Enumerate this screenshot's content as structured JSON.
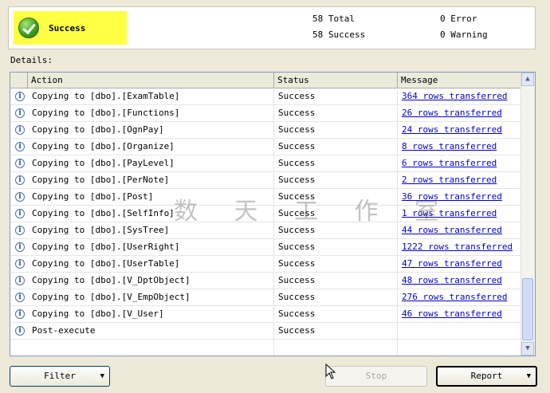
{
  "summary": {
    "status": "Success",
    "total": "58 Total",
    "success": "58 Success",
    "error": "0 Error",
    "warning": "0 Warning"
  },
  "details_label": "Details:",
  "columns": [
    "Action",
    "Status",
    "Message"
  ],
  "rows": [
    {
      "action": "Copying to [dbo].[ExamTable]",
      "status": "Success",
      "message": "364 rows transferred"
    },
    {
      "action": "Copying to [dbo].[Functions]",
      "status": "Success",
      "message": "26 rows transferred"
    },
    {
      "action": "Copying to [dbo].[OgnPay]",
      "status": "Success",
      "message": "24 rows transferred"
    },
    {
      "action": "Copying to [dbo].[Organize]",
      "status": "Success",
      "message": "8 rows transferred"
    },
    {
      "action": "Copying to [dbo].[PayLevel]",
      "status": "Success",
      "message": "6 rows transferred"
    },
    {
      "action": "Copying to [dbo].[PerNote]",
      "status": "Success",
      "message": "2 rows transferred"
    },
    {
      "action": "Copying to [dbo].[Post]",
      "status": "Success",
      "message": "36 rows transferred"
    },
    {
      "action": "Copying to [dbo].[SelfInfo]",
      "status": "Success",
      "message": "1 rows transferred"
    },
    {
      "action": "Copying to [dbo].[SysTree]",
      "status": "Success",
      "message": "44 rows transferred"
    },
    {
      "action": "Copying to [dbo].[UserRight]",
      "status": "Success",
      "message": "1222 rows transferred"
    },
    {
      "action": "Copying to [dbo].[UserTable]",
      "status": "Success",
      "message": "47 rows transferred"
    },
    {
      "action": "Copying to [dbo].[V_DptObject]",
      "status": "Success",
      "message": "48 rows transferred"
    },
    {
      "action": "Copying to [dbo].[V_EmpObject]",
      "status": "Success",
      "message": "276 rows transferred"
    },
    {
      "action": "Copying to [dbo].[V_User]",
      "status": "Success",
      "message": "46 rows transferred"
    },
    {
      "action": "Post-execute",
      "status": "Success",
      "message": ""
    }
  ],
  "buttons": {
    "filter": "Filter",
    "stop": "Stop",
    "report": "Report"
  },
  "watermark": "数 天 工 作 室",
  "icons": {
    "status": "check-circle-icon",
    "row": "info-icon"
  },
  "colors": {
    "highlight": "#ffff44",
    "link": "#0000cc"
  }
}
